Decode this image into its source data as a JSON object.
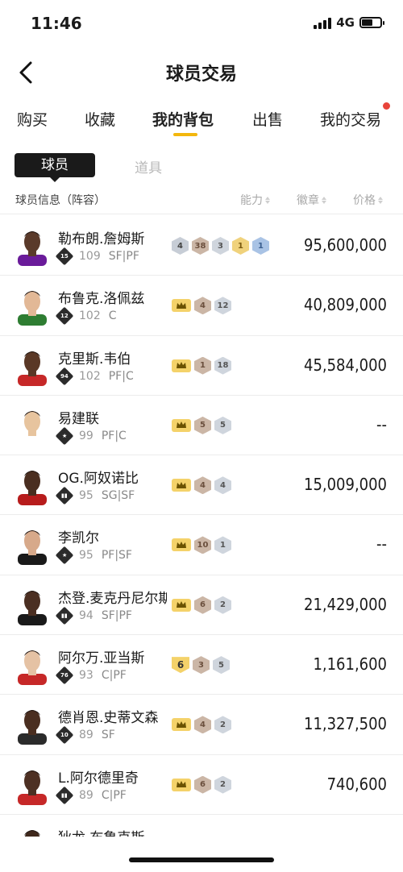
{
  "status_bar": {
    "time": "11:46",
    "network": "4G"
  },
  "nav": {
    "title": "球员交易"
  },
  "tabs": [
    {
      "label": "购买"
    },
    {
      "label": "收藏"
    },
    {
      "label": "我的背包",
      "active": true
    },
    {
      "label": "出售"
    },
    {
      "label": "我的交易",
      "has_dot": true
    }
  ],
  "subtabs": {
    "active": "球员",
    "inactive": "道具"
  },
  "list_header": {
    "info": "球员信息（阵容）",
    "ability": "能力",
    "badge": "徽章",
    "price": "价格"
  },
  "players": [
    {
      "name": "勒布朗.詹姆斯",
      "team_badge": "15",
      "rating": "109",
      "pos": "SF|PF",
      "badges": [
        [
          "gray",
          "4"
        ],
        [
          "bronze",
          "38"
        ],
        [
          "silver",
          "3"
        ],
        [
          "gold",
          "1"
        ],
        [
          "blue",
          "1"
        ]
      ],
      "price": "95,600,000",
      "skin": "#5a3a2a",
      "jersey": "#6a1b9a"
    },
    {
      "name": "布鲁克.洛佩兹",
      "team_badge": "12",
      "rating": "102",
      "pos": "C",
      "badges": [
        [
          "crown",
          ""
        ],
        [
          "bronze",
          "4"
        ],
        [
          "silver",
          "12"
        ]
      ],
      "price": "40,809,000",
      "skin": "#e2b896",
      "jersey": "#2e7d32"
    },
    {
      "name": "克里斯.韦伯",
      "team_badge": "94",
      "rating": "102",
      "pos": "PF|C",
      "badges": [
        [
          "crown",
          ""
        ],
        [
          "bronze",
          "1"
        ],
        [
          "silver",
          "18"
        ]
      ],
      "price": "45,584,000",
      "skin": "#5a3826",
      "jersey": "#c62828"
    },
    {
      "name": "易建联",
      "team_badge": "★",
      "rating": "99",
      "pos": "PF|C",
      "badges": [
        [
          "crown",
          ""
        ],
        [
          "bronze",
          "5"
        ],
        [
          "silver",
          "5"
        ]
      ],
      "price": "--",
      "skin": "#e7c49e",
      "jersey": "#ffffff"
    },
    {
      "name": "OG.阿奴诺比",
      "team_badge": "▮▮",
      "rating": "95",
      "pos": "SG|SF",
      "badges": [
        [
          "crown",
          ""
        ],
        [
          "bronze",
          "4"
        ],
        [
          "silver",
          "4"
        ]
      ],
      "price": "15,009,000",
      "skin": "#4a2e20",
      "jersey": "#b71c1c"
    },
    {
      "name": "李凯尔",
      "team_badge": "★",
      "rating": "95",
      "pos": "PF|SF",
      "badges": [
        [
          "crown",
          ""
        ],
        [
          "bronze",
          "10"
        ],
        [
          "silver",
          "1"
        ]
      ],
      "price": "--",
      "skin": "#d7a98a",
      "jersey": "#1a1a1a"
    },
    {
      "name": "杰登.麦克丹尼尔斯",
      "team_badge": "▮▮",
      "rating": "94",
      "pos": "SF|PF",
      "badges": [
        [
          "crown",
          ""
        ],
        [
          "bronze",
          "6"
        ],
        [
          "silver",
          "2"
        ]
      ],
      "price": "21,429,000",
      "skin": "#4b2f22",
      "jersey": "#1a1a1a"
    },
    {
      "name": "阿尔万.亚当斯",
      "team_badge": "76",
      "rating": "93",
      "pos": "C|PF",
      "badges": [
        [
          "shield",
          "6"
        ],
        [
          "bronze",
          "3"
        ],
        [
          "silver",
          "5"
        ]
      ],
      "price": "1,161,600",
      "skin": "#e5c2a4",
      "jersey": "#c62828"
    },
    {
      "name": "德肖恩.史蒂文森",
      "team_badge": "10",
      "rating": "89",
      "pos": "SF",
      "badges": [
        [
          "crown",
          ""
        ],
        [
          "bronze",
          "4"
        ],
        [
          "silver",
          "2"
        ]
      ],
      "price": "11,327,500",
      "skin": "#4a2e20",
      "jersey": "#2b2b2b"
    },
    {
      "name": "L.阿尔德里奇",
      "team_badge": "▮▮",
      "rating": "89",
      "pos": "C|PF",
      "badges": [
        [
          "crown",
          ""
        ],
        [
          "bronze",
          "6"
        ],
        [
          "silver",
          "2"
        ]
      ],
      "price": "740,600",
      "skin": "#4d3023",
      "jersey": "#c62828"
    },
    {
      "name": "狄龙.布鲁克斯",
      "team_badge": "",
      "rating": "",
      "pos": "",
      "badges": [],
      "price": "",
      "skin": "#3f281c",
      "jersey": "#1a1a1a"
    }
  ]
}
